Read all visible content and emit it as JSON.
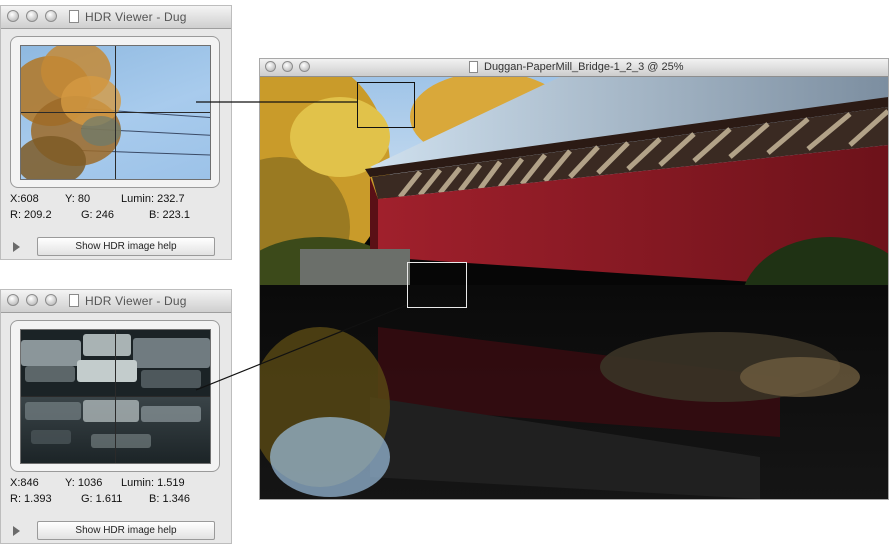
{
  "viewer_top": {
    "title": "HDR Viewer - Dug",
    "x_label": "X:608",
    "y_label": "Y: 80",
    "lumin_label": "Lumin: 232.7",
    "r_label": "R: 209.2",
    "g_label": "G: 246",
    "b_label": "B: 223.1",
    "help_button": "Show HDR image help"
  },
  "viewer_bottom": {
    "title": "HDR Viewer - Dug",
    "x_label": "X:846",
    "y_label": "Y: 1036",
    "lumin_label": "Lumin: 1.519",
    "r_label": "R: 1.393",
    "g_label": "G: 1.611",
    "b_label": "B: 1.346",
    "help_button": "Show HDR image help"
  },
  "main_window": {
    "title": "Duggan-PaperMill_Bridge-1_2_3 @ 25%"
  },
  "colors": {
    "bridge_red": "#8b1a24",
    "sky_blue": "#a8cbed",
    "foliage_yellow": "#e6c23a"
  },
  "icons": [
    "window-close-light",
    "window-minimize-light",
    "window-zoom-light",
    "document-icon",
    "disclosure-triangle-icon"
  ]
}
